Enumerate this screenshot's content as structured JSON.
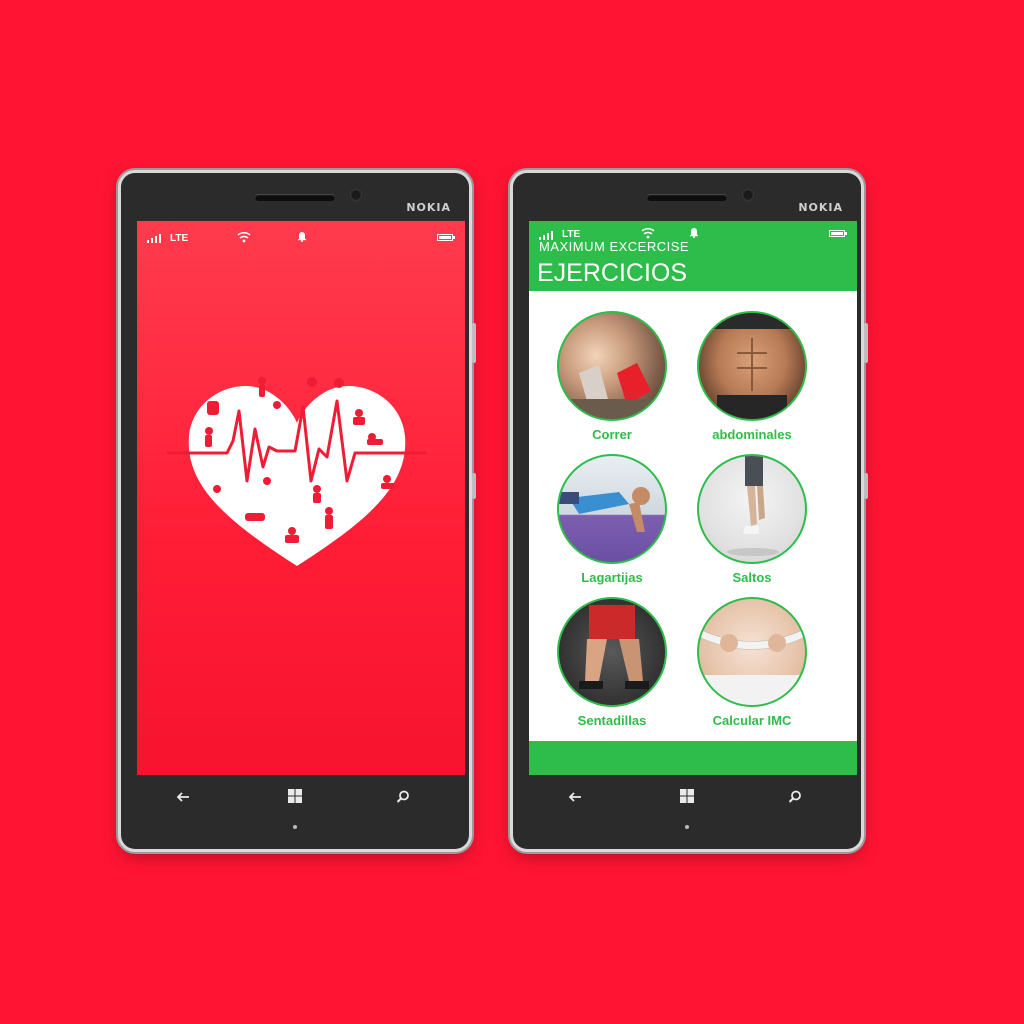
{
  "brand": "NOKIA",
  "status": {
    "network": "LTE"
  },
  "app": {
    "name": "MAXIMUM EXCERCISE",
    "section_title": "EJERCICIOS",
    "exercises": [
      {
        "label": "Correr"
      },
      {
        "label": "abdominales"
      },
      {
        "label": "Lagartijas"
      },
      {
        "label": "Saltos"
      },
      {
        "label": "Sentadillas"
      },
      {
        "label": "Calcular IMC"
      }
    ]
  },
  "colors": {
    "background": "#ff1433",
    "accent_green": "#2ebd4a",
    "splash_red": "#ff1c35"
  },
  "icons": {
    "back": "back-arrow-icon",
    "start": "windows-logo-icon",
    "search": "search-icon"
  }
}
